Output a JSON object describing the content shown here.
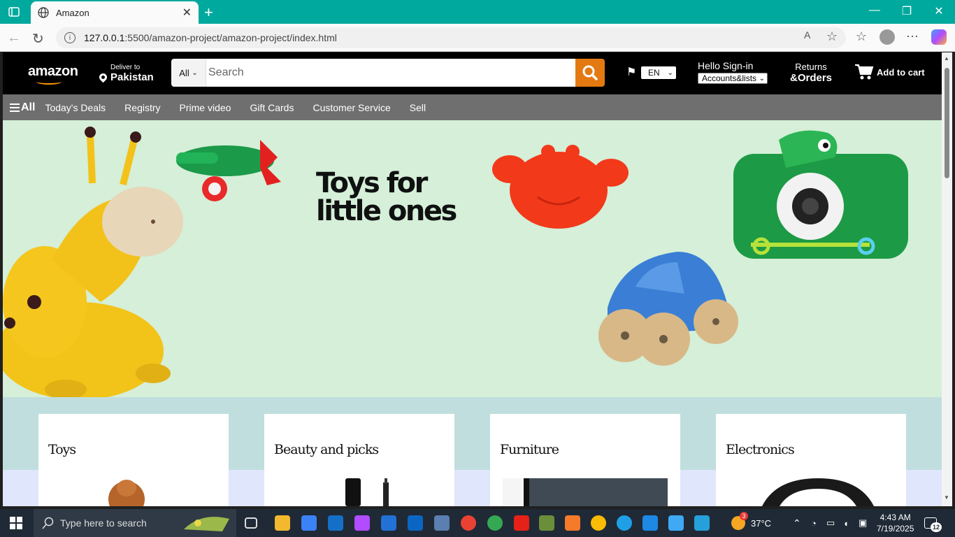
{
  "browser": {
    "tab_title": "Amazon",
    "url_host": "127.0.0.1",
    "url_rest": ":5500/amazon-project/amazon-project/index.html"
  },
  "header": {
    "logo": "amazon",
    "deliver_small": "Deliver to",
    "deliver_location": "Pakistan",
    "search_category": "All",
    "search_placeholder": "Search",
    "language": "EN",
    "hello": "Hello Sign-in",
    "accounts": "Accounts&lists",
    "returns_line1": "Returns",
    "returns_line2": "&Orders",
    "cart": "Add to cart"
  },
  "nav": {
    "all": "All",
    "items": [
      "Today's Deals",
      "Registry",
      "Prime video",
      "Gift Cards",
      "Customer Service",
      "Sell"
    ]
  },
  "hero": {
    "title_line1": "Toys for",
    "title_line2": "little ones"
  },
  "cards": [
    {
      "title": "Toys"
    },
    {
      "title": "Beauty and picks"
    },
    {
      "title": "Furniture"
    },
    {
      "title": "Electronics"
    }
  ],
  "taskbar": {
    "search_placeholder": "Type here to search",
    "weather": "37°C",
    "weather_badge": "3",
    "time": "4:43 AM",
    "date": "7/19/2025",
    "notifications": "12"
  },
  "colors": {
    "tabbar": "#00a99d",
    "amazon_orange": "#e47911",
    "hero_bg": "#d5efd8",
    "nav_bg": "#6f6f6f"
  }
}
